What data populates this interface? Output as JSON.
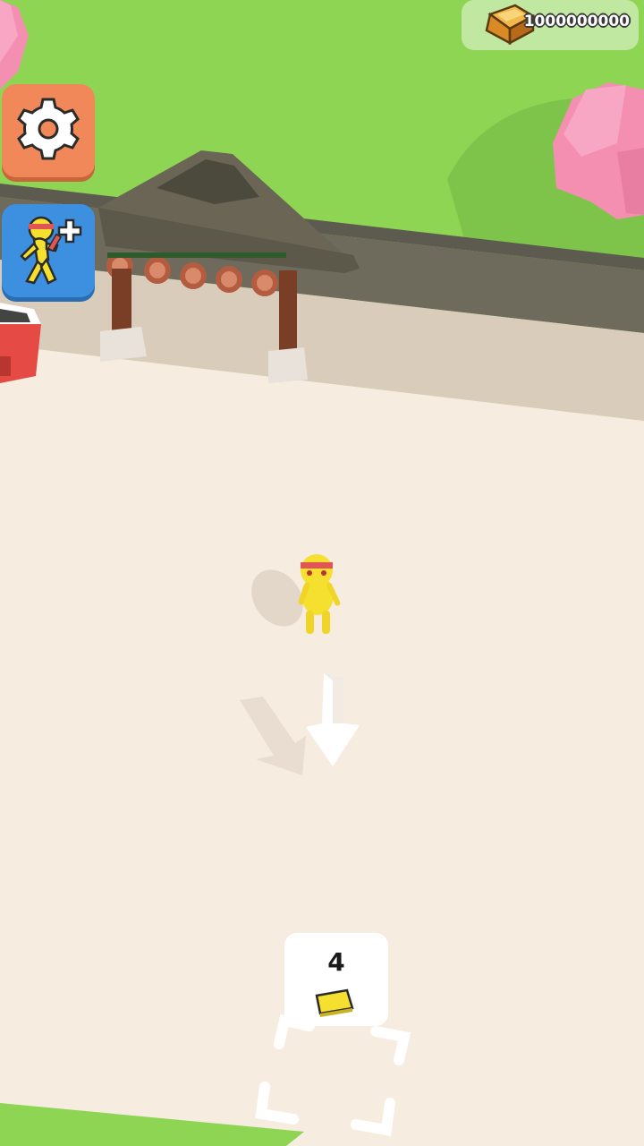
{
  "hud": {
    "currency_amount": "1000000000",
    "currency_icon": "gold-bar-icon",
    "settings_icon": "gear-icon",
    "hire_icon": "ninja-add-icon"
  },
  "purchase_zone": {
    "price": "4",
    "price_icon": "gold-bar-icon"
  },
  "colors": {
    "grass": "#8ed553",
    "floor": "#f7ece0",
    "wall": "#6e6a5c",
    "settings_button": "#f0885a",
    "hire_button": "#3d8fe0",
    "character": "#f5e030",
    "blossom": "#f48fb1"
  }
}
